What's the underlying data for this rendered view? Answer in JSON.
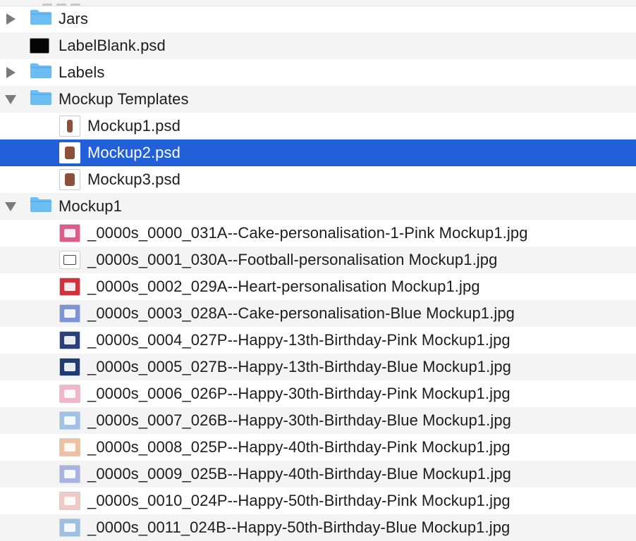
{
  "rows": [
    {
      "label": "Jars",
      "level": 0,
      "kind": "folder",
      "disclosure": "collapsed"
    },
    {
      "label": "LabelBlank.psd",
      "level": 0,
      "kind": "psd-black",
      "disclosure": "none"
    },
    {
      "label": "Labels",
      "level": 0,
      "kind": "folder",
      "disclosure": "collapsed"
    },
    {
      "label": "Mockup Templates",
      "level": 0,
      "kind": "folder",
      "disclosure": "expanded"
    },
    {
      "label": "Mockup1.psd",
      "level": 1,
      "kind": "psd-one",
      "disclosure": "none"
    },
    {
      "label": "Mockup2.psd",
      "level": 1,
      "kind": "psd-two",
      "disclosure": "none",
      "selected": true
    },
    {
      "label": "Mockup3.psd",
      "level": 1,
      "kind": "psd-two",
      "disclosure": "none"
    },
    {
      "label": "Mockup1",
      "level": 0,
      "kind": "folder",
      "disclosure": "expanded"
    },
    {
      "label": "_0000s_0000_031A--Cake-personalisation-1-Pink Mockup1.jpg",
      "level": 1,
      "kind": "jpg",
      "thumb_color": "#e05a8a"
    },
    {
      "label": "_0000s_0001_030A--Football-personalisation Mockup1.jpg",
      "level": 1,
      "kind": "jpg",
      "thumb_color": "#ffffff"
    },
    {
      "label": "_0000s_0002_029A--Heart-personalisation Mockup1.jpg",
      "level": 1,
      "kind": "jpg",
      "thumb_color": "#d6313a"
    },
    {
      "label": "_0000s_0003_028A--Cake-personalisation-Blue Mockup1.jpg",
      "level": 1,
      "kind": "jpg",
      "thumb_color": "#7d94d8"
    },
    {
      "label": "_0000s_0004_027P--Happy-13th-Birthday-Pink Mockup1.jpg",
      "level": 1,
      "kind": "jpg",
      "thumb_color": "#2b3f7c"
    },
    {
      "label": "_0000s_0005_027B--Happy-13th-Birthday-Blue Mockup1.jpg",
      "level": 1,
      "kind": "jpg",
      "thumb_color": "#1f3d74"
    },
    {
      "label": "_0000s_0006_026P--Happy-30th-Birthday-Pink Mockup1.jpg",
      "level": 1,
      "kind": "jpg",
      "thumb_color": "#f2b6c8"
    },
    {
      "label": "_0000s_0007_026B--Happy-30th-Birthday-Blue Mockup1.jpg",
      "level": 1,
      "kind": "jpg",
      "thumb_color": "#9fc3e8"
    },
    {
      "label": "_0000s_0008_025P--Happy-40th-Birthday-Pink Mockup1.jpg",
      "level": 1,
      "kind": "jpg",
      "thumb_color": "#f0c0a0"
    },
    {
      "label": "_0000s_0009_025B--Happy-40th-Birthday-Blue Mockup1.jpg",
      "level": 1,
      "kind": "jpg",
      "thumb_color": "#a7b3e4"
    },
    {
      "label": "_0000s_0010_024P--Happy-50th-Birthday-Pink Mockup1.jpg",
      "level": 1,
      "kind": "jpg",
      "thumb_color": "#f3c9c4"
    },
    {
      "label": "_0000s_0011_024B--Happy-50th-Birthday-Blue Mockup1.jpg",
      "level": 1,
      "kind": "jpg",
      "thumb_color": "#9dc0e6"
    }
  ],
  "colors": {
    "selection": "#2160d8",
    "stripe": "#f4f4f4",
    "folder": "#6bbdf3",
    "disclosure": "#7a7a7a"
  }
}
